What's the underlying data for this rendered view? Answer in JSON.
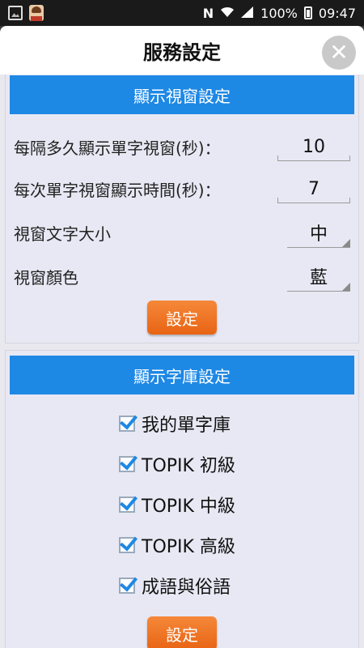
{
  "status_bar": {
    "signal_n": "N",
    "battery_percent": "100%",
    "time": "09:47"
  },
  "dialog": {
    "title": "服務設定",
    "close_glyph": "✕"
  },
  "window_settings": {
    "header": "顯示視窗設定",
    "interval_label": "每隔多久顯示單字視窗(秒)：",
    "interval_value": "10",
    "duration_label": "每次單字視窗顯示時間(秒)：",
    "duration_value": "7",
    "font_size_label": "視窗文字大小",
    "font_size_value": "中",
    "color_label": "視窗顏色",
    "color_value": "藍",
    "set_button": "設定"
  },
  "library_settings": {
    "header": "顯示字庫設定",
    "items": [
      {
        "label": "我的單字庫",
        "checked": true
      },
      {
        "label": "TOPIK 初級",
        "checked": true
      },
      {
        "label": "TOPIK 中級",
        "checked": true
      },
      {
        "label": "TOPIK 高級",
        "checked": true
      },
      {
        "label": "成語與俗語",
        "checked": true
      }
    ],
    "set_button": "設定"
  },
  "colors": {
    "header_blue": "#1e88e5",
    "button_orange": "#ee7020",
    "panel_bg": "#e8e8f4"
  }
}
